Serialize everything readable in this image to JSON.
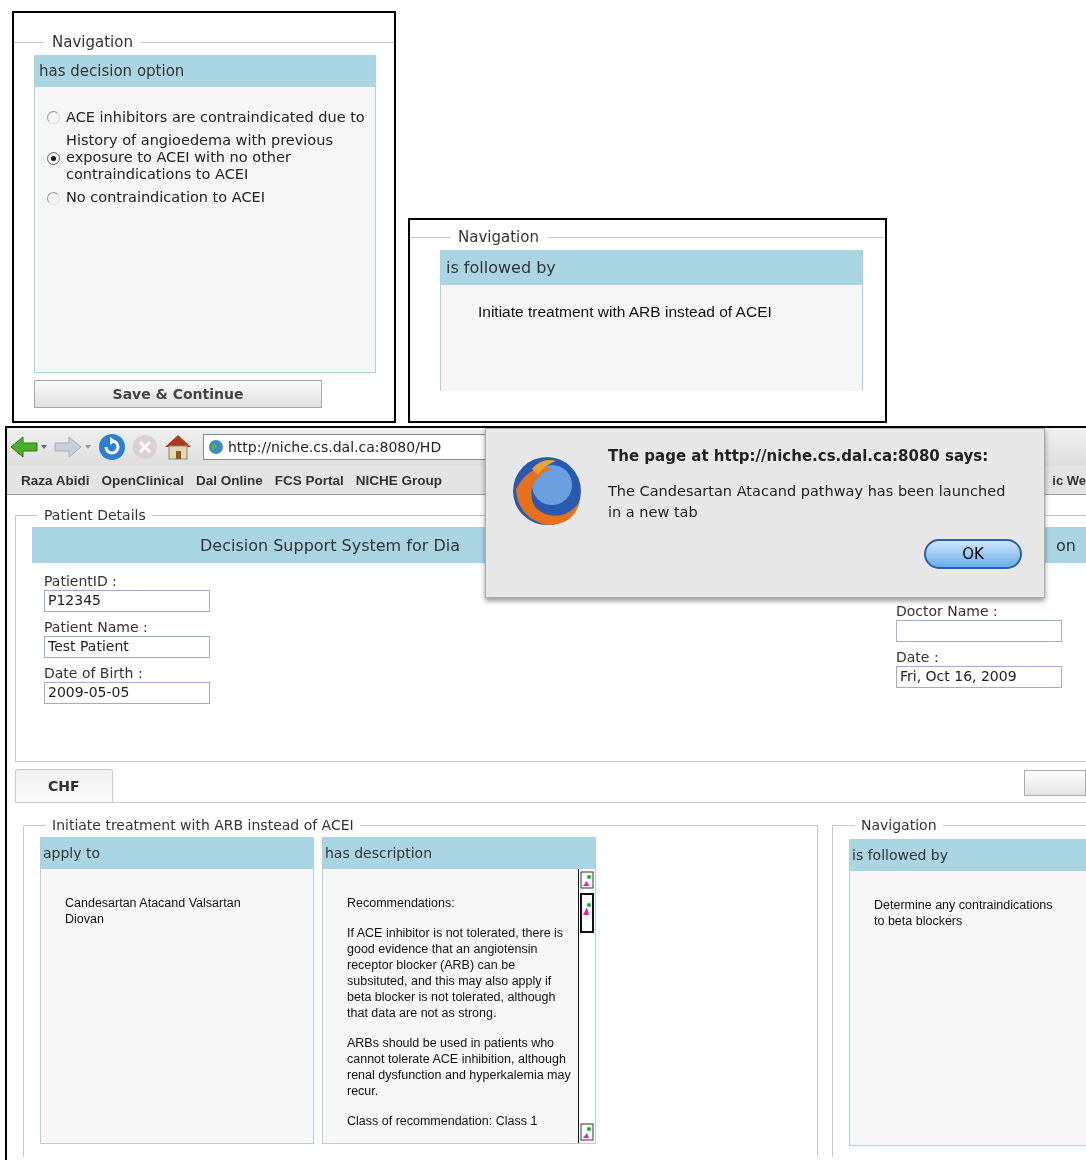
{
  "decision_panel": {
    "legend": "Navigation",
    "header": "has decision option",
    "options": [
      {
        "label": "ACE inhibitors are contraindicated due to",
        "selected": false
      },
      {
        "label": "History of angioedema with previous exposure to ACEI with no other contraindications to ACEI",
        "selected": true
      },
      {
        "label": "No contraindication to ACEI",
        "selected": false
      }
    ],
    "button": "Save & Continue"
  },
  "followed_panel": {
    "legend": "Navigation",
    "header": "is followed by",
    "text": "Initiate treatment with ARB instead of ACEI"
  },
  "browser": {
    "url": "http://niche.cs.dal.ca:8080/HD",
    "bookmarks": [
      "Raza Abidi",
      "OpenClinical",
      "Dal Online",
      "FCS Portal",
      "NICHE Group"
    ],
    "bookmark_cut": "ic We",
    "dialog": {
      "title": "The page at http://niche.cs.dal.ca:8080 says:",
      "message": "The Candesartan Atacand pathway has been launched in a new tab",
      "button": "OK"
    },
    "patient_details": {
      "legend": "Patient Details",
      "title_left": "Decision Support System for Dia",
      "title_right": "on",
      "fields_left": [
        {
          "label": "PatientID :",
          "value": "P12345"
        },
        {
          "label": "Patient Name :",
          "value": "Test Patient"
        },
        {
          "label": "Date of Birth :",
          "value": "2009-05-05"
        }
      ],
      "fields_right": [
        {
          "label": "Doctor Name :"
        },
        {
          "label": "Date :",
          "value": "Fri, Oct 16, 2009"
        }
      ]
    },
    "tabs": [
      {
        "label": "CHF",
        "selected": true
      }
    ],
    "step": {
      "legend": "Initiate treatment with ARB instead of ACEI",
      "boxes": [
        {
          "kind": "text",
          "header": "apply to",
          "text": "Candesartan Atacand Valsartan Diovan"
        },
        {
          "kind": "scroll",
          "header": "has description",
          "paragraphs": [
            "Recommendations:",
            "If ACE inhibitor is not tolerated, there is good evidence that an angiotensin receptor blocker (ARB) can be subsituted, and this may also apply if beta blocker is not tolerated, although that data are not as strong.",
            "ARBs should be used in patients who cannot tolerate ACE inhibition, although renal dysfunction and hyperkalemia may recur.",
            "Class of recommendation: Class 1"
          ]
        }
      ]
    },
    "navigation": {
      "legend": "Navigation",
      "header": "is followed by",
      "text": "Determine any contraindications to beta blockers"
    }
  }
}
